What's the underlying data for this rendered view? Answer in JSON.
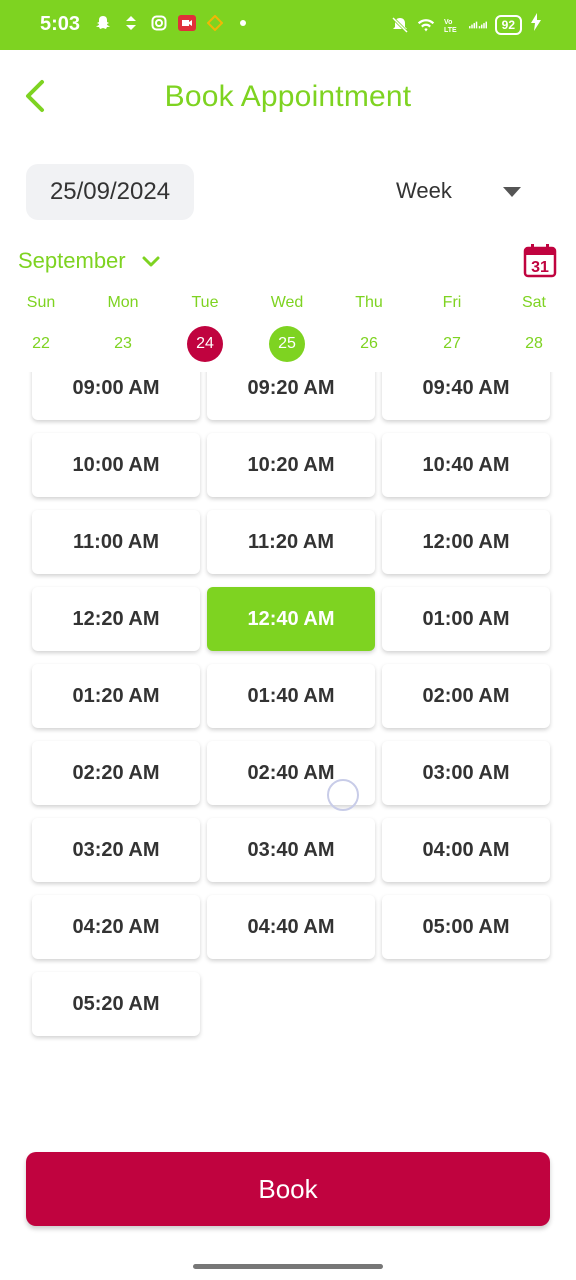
{
  "status_bar": {
    "time": "5:03",
    "battery": "92",
    "icons_left": [
      "snapchat-icon",
      "arrows-icon",
      "instagram-icon",
      "video-icon",
      "app-icon",
      "dot-icon"
    ],
    "icons_right": [
      "mute-icon",
      "wifi-icon",
      "lte-icon",
      "signal-icon",
      "battery-icon",
      "charging-icon"
    ]
  },
  "header": {
    "title": "Book Appointment"
  },
  "date_selector": {
    "date": "25/09/2024",
    "view_mode": "Week"
  },
  "calendar": {
    "month": "September",
    "calendar_icon_day": "31",
    "days": [
      {
        "name": "Sun",
        "num": "22",
        "state": "normal"
      },
      {
        "name": "Mon",
        "num": "23",
        "state": "normal"
      },
      {
        "name": "Tue",
        "num": "24",
        "state": "today"
      },
      {
        "name": "Wed",
        "num": "25",
        "state": "selected"
      },
      {
        "name": "Thu",
        "num": "26",
        "state": "normal"
      },
      {
        "name": "Fri",
        "num": "27",
        "state": "normal"
      },
      {
        "name": "Sat",
        "num": "28",
        "state": "normal"
      }
    ]
  },
  "slots": [
    "09:00 AM",
    "09:20 AM",
    "09:40 AM",
    "10:00 AM",
    "10:20 AM",
    "10:40 AM",
    "11:00 AM",
    "11:20 AM",
    "12:00 AM",
    "12:20 AM",
    "12:40 AM",
    "01:00 AM",
    "01:20 AM",
    "01:40 AM",
    "02:00 AM",
    "02:20 AM",
    "02:40 AM",
    "03:00 AM",
    "03:20 AM",
    "03:40 AM",
    "04:00 AM",
    "04:20 AM",
    "04:40 AM",
    "05:00 AM",
    "05:20 AM"
  ],
  "selected_slot": "12:40 AM",
  "actions": {
    "book_label": "Book"
  },
  "colors": {
    "accent_green": "#7ed321",
    "accent_red": "#c0033f"
  }
}
